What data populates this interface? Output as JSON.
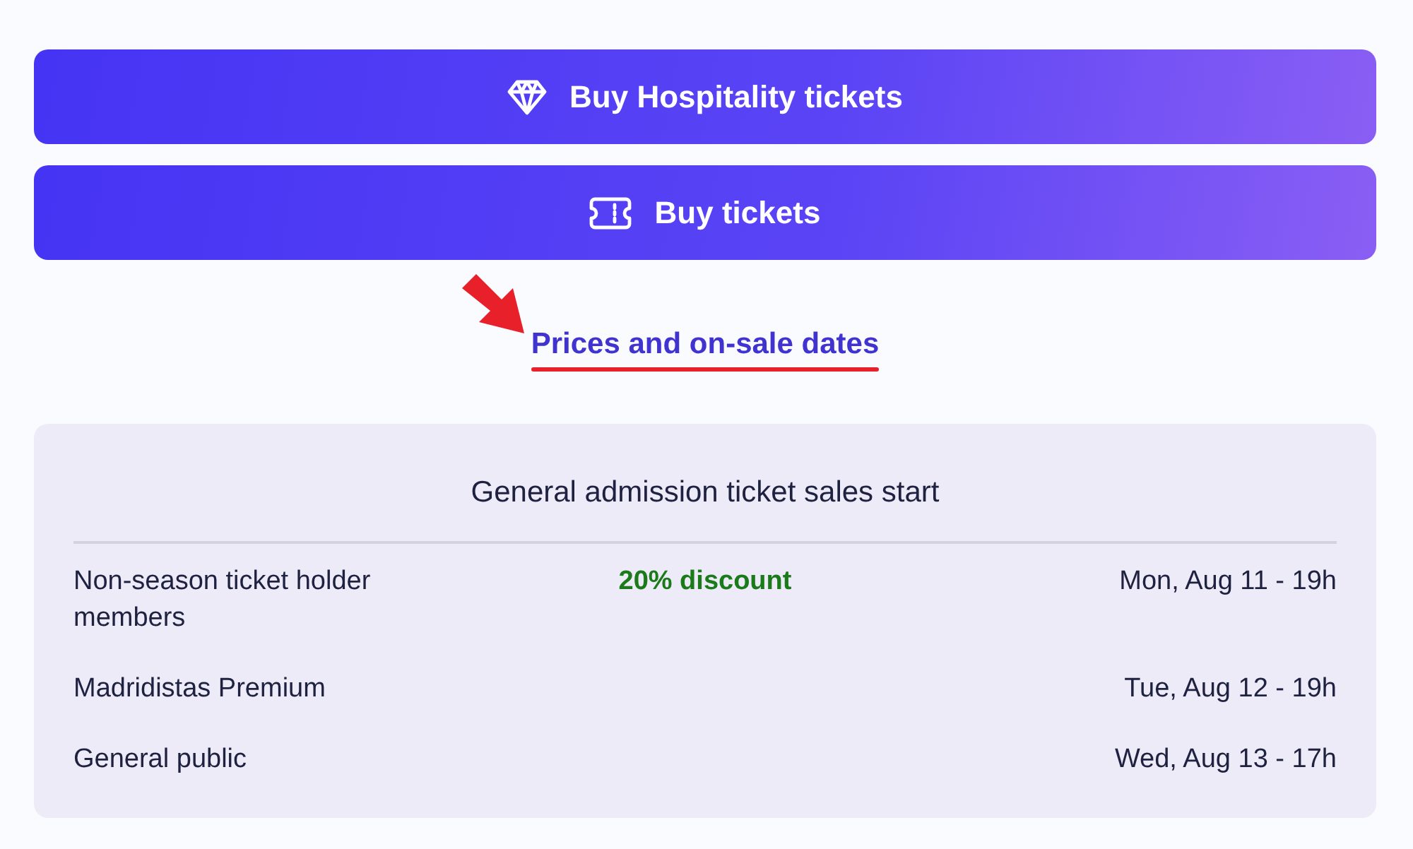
{
  "buttons": [
    {
      "label": "Buy Hospitality tickets",
      "kind": "hospitality"
    },
    {
      "label": "Buy tickets",
      "kind": "tickets"
    }
  ],
  "link": {
    "label": "Prices and on-sale dates"
  },
  "sales_card": {
    "title": "General admission ticket sales start",
    "rows": [
      {
        "audience": "Non-season ticket holder members",
        "note": "20% discount",
        "date": "Mon, Aug 11 - 19h"
      },
      {
        "audience": "Madridistas Premium",
        "date": "Tue, Aug 12 - 19h"
      },
      {
        "audience": "General public",
        "date": "Wed, Aug 13 - 17h"
      }
    ]
  }
}
